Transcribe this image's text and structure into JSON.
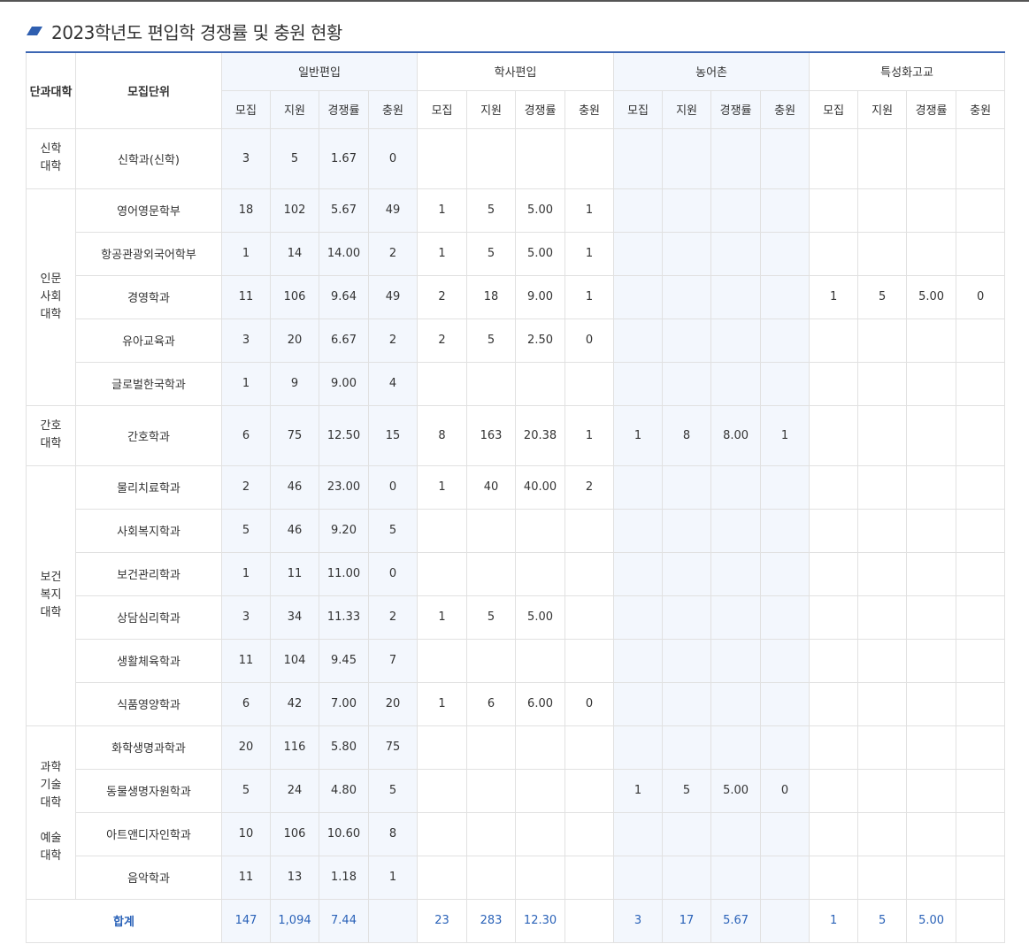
{
  "title": "2023학년도 편입학 경쟁률 및 충원 현황",
  "colors": {
    "accent": "#3c66b3",
    "tint": "#f3f7fd",
    "total_text": "#2a62b8"
  },
  "header": {
    "college": "단과대학",
    "unit": "모집단위",
    "groups": [
      "일반편입",
      "학사편입",
      "농어촌",
      "특성화고교"
    ],
    "sub": [
      "모집",
      "지원",
      "경쟁률",
      "충원"
    ]
  },
  "colleges": [
    {
      "label": "신학\n대학",
      "span": 1
    },
    {
      "label": "인문\n사회\n대학",
      "span": 5
    },
    {
      "label": "간호\n대학",
      "span": 1
    },
    {
      "label": "보건\n복지\n대학",
      "span": 6
    },
    {
      "label": "과학\n기술\n대학\n\n예술\n대학",
      "span": 4
    }
  ],
  "rows": [
    {
      "unit": "신학과(신학)",
      "cells": [
        "3",
        "5",
        "1.67",
        "0",
        "",
        "",
        "",
        "",
        "",
        "",
        "",
        "",
        "",
        "",
        "",
        ""
      ]
    },
    {
      "unit": "영어영문학부",
      "cells": [
        "18",
        "102",
        "5.67",
        "49",
        "1",
        "5",
        "5.00",
        "1",
        "",
        "",
        "",
        "",
        "",
        "",
        "",
        ""
      ]
    },
    {
      "unit": "항공관광외국어학부",
      "cells": [
        "1",
        "14",
        "14.00",
        "2",
        "1",
        "5",
        "5.00",
        "1",
        "",
        "",
        "",
        "",
        "",
        "",
        "",
        ""
      ]
    },
    {
      "unit": "경영학과",
      "cells": [
        "11",
        "106",
        "9.64",
        "49",
        "2",
        "18",
        "9.00",
        "1",
        "",
        "",
        "",
        "",
        "1",
        "5",
        "5.00",
        "0"
      ]
    },
    {
      "unit": "유아교육과",
      "cells": [
        "3",
        "20",
        "6.67",
        "2",
        "2",
        "5",
        "2.50",
        "0",
        "",
        "",
        "",
        "",
        "",
        "",
        "",
        ""
      ]
    },
    {
      "unit": "글로벌한국학과",
      "cells": [
        "1",
        "9",
        "9.00",
        "4",
        "",
        "",
        "",
        "",
        "",
        "",
        "",
        "",
        "",
        "",
        "",
        ""
      ]
    },
    {
      "unit": "간호학과",
      "cells": [
        "6",
        "75",
        "12.50",
        "15",
        "8",
        "163",
        "20.38",
        "1",
        "1",
        "8",
        "8.00",
        "1",
        "",
        "",
        "",
        ""
      ]
    },
    {
      "unit": "물리치료학과",
      "cells": [
        "2",
        "46",
        "23.00",
        "0",
        "1",
        "40",
        "40.00",
        "2",
        "",
        "",
        "",
        "",
        "",
        "",
        "",
        ""
      ]
    },
    {
      "unit": "사회복지학과",
      "cells": [
        "5",
        "46",
        "9.20",
        "5",
        "",
        "",
        "",
        "",
        "",
        "",
        "",
        "",
        "",
        "",
        "",
        ""
      ]
    },
    {
      "unit": "보건관리학과",
      "cells": [
        "1",
        "11",
        "11.00",
        "0",
        "",
        "",
        "",
        "",
        "",
        "",
        "",
        "",
        "",
        "",
        "",
        ""
      ]
    },
    {
      "unit": "상담심리학과",
      "cells": [
        "3",
        "34",
        "11.33",
        "2",
        "1",
        "5",
        "5.00",
        "",
        "",
        "",
        "",
        "",
        "",
        "",
        "",
        ""
      ]
    },
    {
      "unit": "생활체육학과",
      "cells": [
        "11",
        "104",
        "9.45",
        "7",
        "",
        "",
        "",
        "",
        "",
        "",
        "",
        "",
        "",
        "",
        "",
        ""
      ]
    },
    {
      "unit": "식품영양학과",
      "cells": [
        "6",
        "42",
        "7.00",
        "20",
        "1",
        "6",
        "6.00",
        "0",
        "",
        "",
        "",
        "",
        "",
        "",
        "",
        ""
      ]
    },
    {
      "unit": "화학생명과학과",
      "cells": [
        "20",
        "116",
        "5.80",
        "75",
        "",
        "",
        "",
        "",
        "",
        "",
        "",
        "",
        "",
        "",
        "",
        ""
      ]
    },
    {
      "unit": "동물생명자원학과",
      "cells": [
        "5",
        "24",
        "4.80",
        "5",
        "",
        "",
        "",
        "",
        "1",
        "5",
        "5.00",
        "0",
        "",
        "",
        "",
        ""
      ]
    },
    {
      "unit": "아트앤디자인학과",
      "cells": [
        "10",
        "106",
        "10.60",
        "8",
        "",
        "",
        "",
        "",
        "",
        "",
        "",
        "",
        "",
        "",
        "",
        ""
      ]
    },
    {
      "unit": "음악학과",
      "cells": [
        "11",
        "13",
        "1.18",
        "1",
        "",
        "",
        "",
        "",
        "",
        "",
        "",
        "",
        "",
        "",
        "",
        ""
      ]
    }
  ],
  "total": {
    "label": "합계",
    "cells": [
      "147",
      "1,094",
      "7.44",
      "",
      "23",
      "283",
      "12.30",
      "",
      "3",
      "17",
      "5.67",
      "",
      "1",
      "5",
      "5.00",
      ""
    ]
  }
}
